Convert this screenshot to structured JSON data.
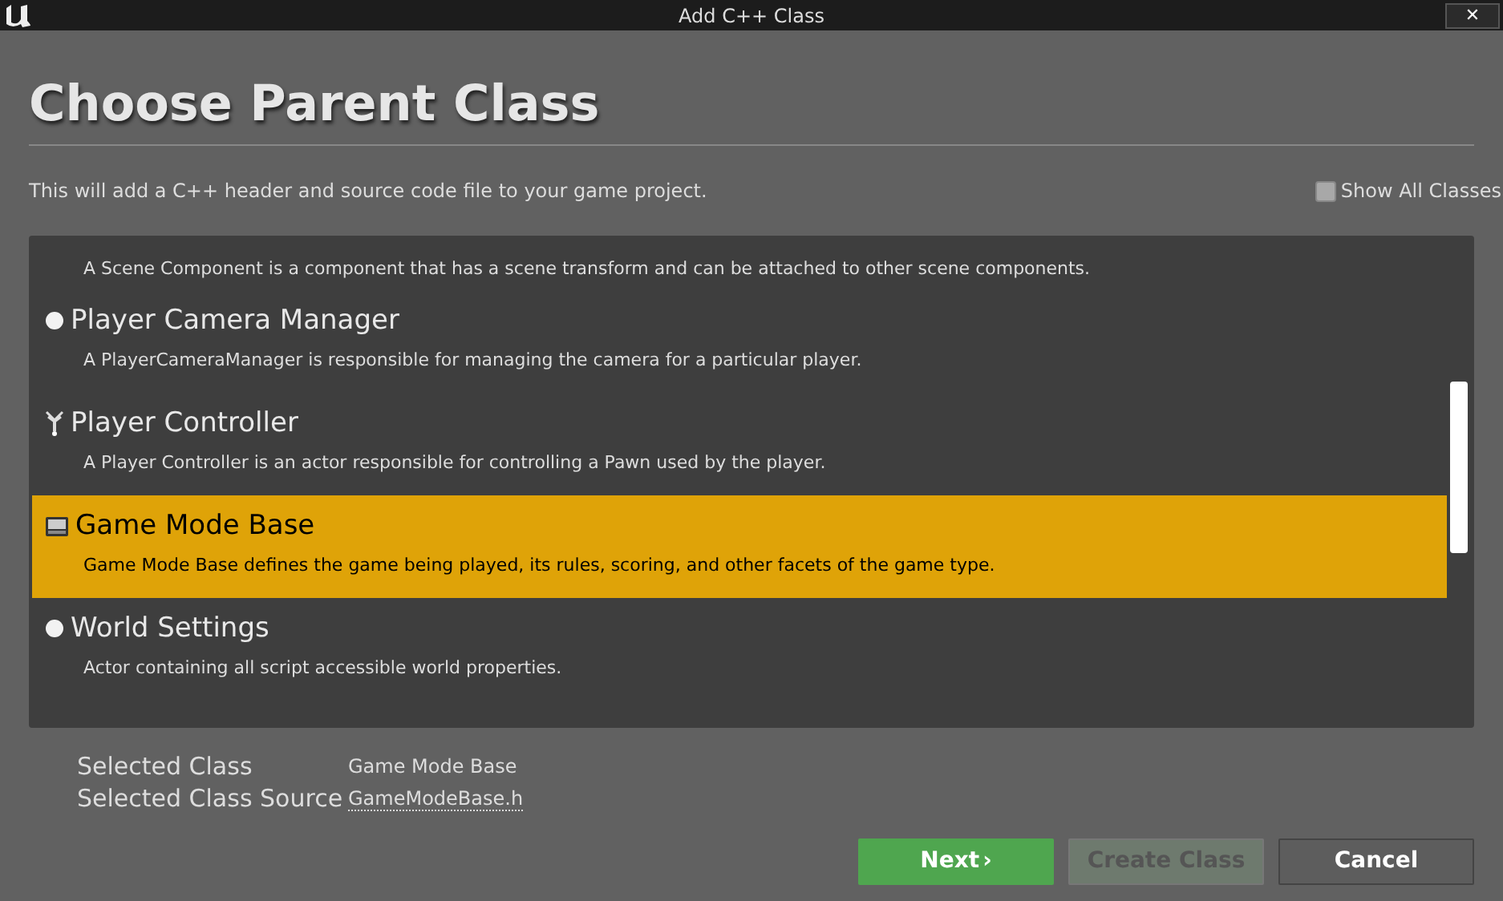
{
  "window": {
    "title": "Add C++ Class",
    "close": "✕"
  },
  "heading": "Choose Parent Class",
  "subtitle": "This will add a C++ header and source code file to your game project.",
  "show_all_classes": {
    "label": "Show All Classes",
    "checked": false
  },
  "class_list": {
    "top_description": "A Scene Component is a component that has a scene transform and can be attached to other scene components.",
    "items": [
      {
        "kind": "sphere",
        "name": "Player Camera Manager",
        "description": "A PlayerCameraManager is responsible for managing the camera for a particular player.",
        "selected": false
      },
      {
        "kind": "controller",
        "name": "Player Controller",
        "description": "A Player Controller is an actor responsible for controlling a Pawn used by the player.",
        "selected": false
      },
      {
        "kind": "game_mode",
        "name": "Game Mode Base",
        "description": "Game Mode Base defines the game being played, its rules, scoring, and other facets of the game type.",
        "selected": true
      },
      {
        "kind": "sphere",
        "name": "World Settings",
        "description": "Actor containing all script accessible world properties.",
        "selected": false
      }
    ]
  },
  "selected_class": {
    "label": "Selected Class",
    "value": "Game Mode Base"
  },
  "selected_class_source": {
    "label": "Selected Class Source",
    "value": "GameModeBase.h"
  },
  "buttons": [
    {
      "label": "Next",
      "kind": "primary",
      "disabled": false,
      "arrow": "›"
    },
    {
      "label": "Create Class",
      "kind": "secondary",
      "disabled": true
    },
    {
      "label": "Cancel",
      "kind": "secondary",
      "disabled": false
    }
  ]
}
